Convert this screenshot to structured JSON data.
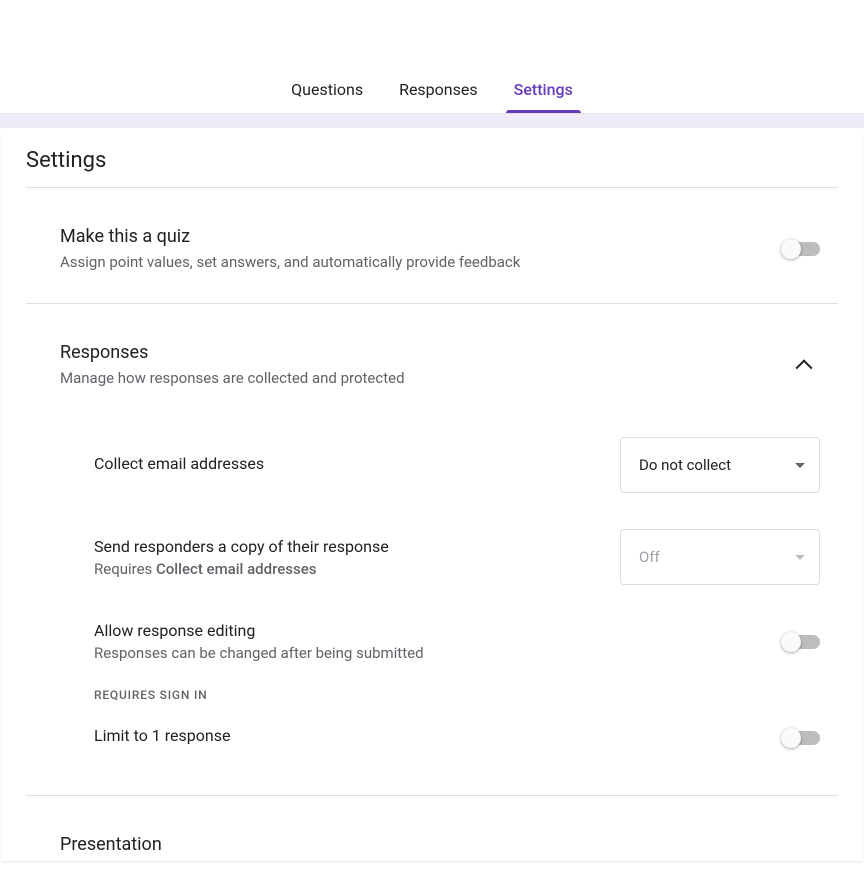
{
  "tabs": {
    "questions": "Questions",
    "responses": "Responses",
    "settings": "Settings"
  },
  "page_title": "Settings",
  "quiz_section": {
    "title": "Make this a quiz",
    "desc": "Assign point values, set answers, and automatically provide feedback"
  },
  "responses_section": {
    "title": "Responses",
    "desc": "Manage how responses are collected and protected",
    "collect_email": {
      "title": "Collect email addresses",
      "value": "Do not collect"
    },
    "send_copy": {
      "title": "Send responders a copy of their response",
      "desc_prefix": "Requires ",
      "desc_bold": "Collect email addresses",
      "value": "Off"
    },
    "allow_editing": {
      "title": "Allow response editing",
      "desc": "Responses can be changed after being submitted"
    },
    "requires_signin_label": "REQUIRES SIGN IN",
    "limit_one": {
      "title": "Limit to 1 response"
    }
  },
  "presentation_section": {
    "title": "Presentation"
  }
}
